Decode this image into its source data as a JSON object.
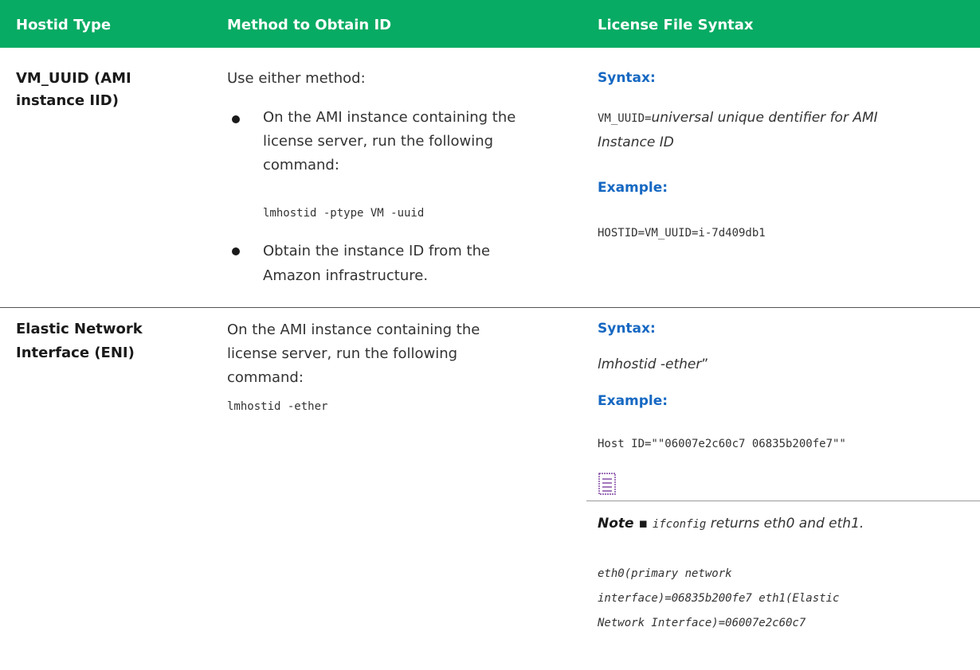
{
  "table": {
    "headers": [
      "Hostid Type",
      "Method to Obtain ID",
      "License File Syntax"
    ],
    "rows": [
      {
        "type_lines": [
          "VM_UUID (AMI",
          "instance IID)"
        ],
        "method_intro": "Use either method:",
        "bullet1_lines": [
          "On the AMI instance containing the",
          "license server, run the following",
          "command:"
        ],
        "command": "lmhostid -ptype VM -uuid",
        "bullet2_lines": [
          "Obtain the instance ID from the",
          "Amazon infrastructure."
        ],
        "syntax_heading": "Syntax:",
        "syntax_code": "VM_UUID=",
        "syntax_italic_1": "universal unique dentifier for AMI",
        "syntax_italic_2": "Instance ID",
        "example_heading": "Example:",
        "example_code": "HOSTID=VM_UUID=i-7d409db1"
      },
      {
        "type_lines": [
          "Elastic Network",
          "Interface (ENI)"
        ],
        "method_lines": [
          "On the AMI instance containing the",
          "license server, run the following",
          "command:"
        ],
        "command": "lmhostid -ether",
        "syntax_heading": "Syntax:",
        "syntax_italic": "lmhostid -ether",
        "syntax_tail": "”",
        "example_heading": "Example:",
        "example_code": "Host ID=\"\"06007e2c60c7 06835b200fe7\"\"",
        "note_icon": "note-icon",
        "note_label": "Note ▪ ",
        "note_code": "ifconfig",
        "note_text": " returns eth0 and eth1.",
        "note_detail_lines": [
          "eth0(primary network",
          "interface)=06835b200fe7 eth1(Elastic",
          "Network Interface)=06007e2c60c7"
        ]
      }
    ]
  },
  "colors": {
    "header_bg": "#07ab63",
    "subheading": "#1668c2",
    "note_icon": "#7b3fa0"
  }
}
